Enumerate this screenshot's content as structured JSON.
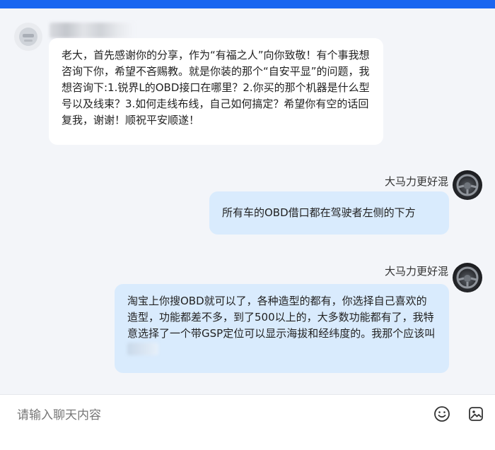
{
  "messages": [
    {
      "direction": "incoming",
      "text": "老大，首先感谢你的分享，作为“有福之人”向你致敬！有个事我想咨询下你，希望不吝赐教。就是你装的那个“自安平显”的问题，我想咨询下:1.锐界L的OBD接口在哪里？2.你买的那个机器是什么型号以及线束？3.如何走线布线，自己如何搞定？希望你有空的话回复我，谢谢！顺祝平安顺遂！"
    },
    {
      "direction": "outgoing",
      "sender": "大马力更好混",
      "text": "所有车的OBD借口都在驾驶者左侧的下方"
    },
    {
      "direction": "outgoing",
      "sender": "大马力更好混",
      "text": "淘宝上你搜OBD就可以了，各种造型的都有，你选择自己喜欢的造型，功能都差不多，到了500以上的，大多数功能都有了，我特意选择了一个带GSP定位可以显示海拔和经纬度的。我那个应该叫"
    }
  ],
  "input": {
    "placeholder": "请输入聊天内容"
  },
  "icons": {
    "emoji": "emoji-icon",
    "image": "image-icon"
  },
  "colors": {
    "topbar": "#1a66f0",
    "background": "#f3f5f9",
    "incoming_bubble": "#ffffff",
    "outgoing_bubble": "#d9ebfd"
  }
}
